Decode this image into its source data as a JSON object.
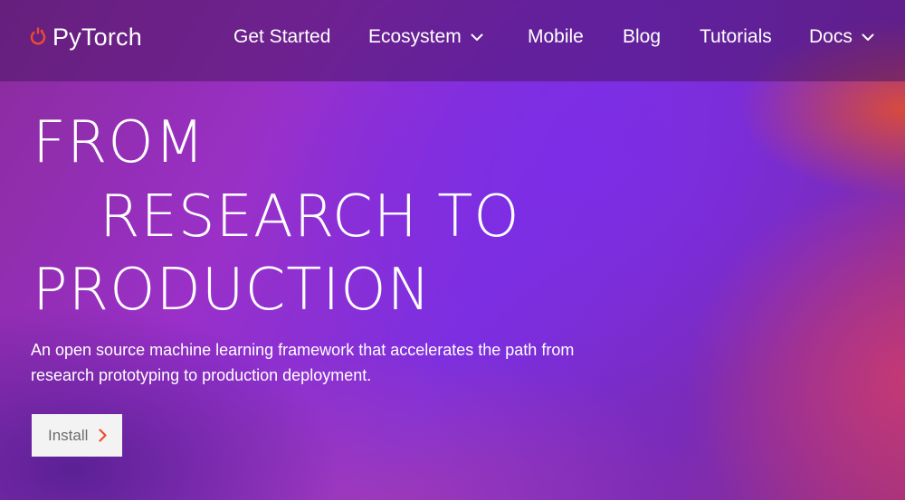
{
  "brand": {
    "name": "PyTorch",
    "logo_icon": "pytorch-flame-icon",
    "accent_color": "#ee4c2c"
  },
  "nav": {
    "items": [
      {
        "label": "Get Started",
        "has_dropdown": false
      },
      {
        "label": "Ecosystem",
        "has_dropdown": true,
        "icon": "chevron-down-icon"
      },
      {
        "label": "Mobile",
        "has_dropdown": false
      },
      {
        "label": "Blog",
        "has_dropdown": false
      },
      {
        "label": "Tutorials",
        "has_dropdown": false
      },
      {
        "label": "Docs",
        "has_dropdown": true,
        "icon": "chevron-down-icon"
      }
    ]
  },
  "hero": {
    "headline": [
      "FROM",
      "RESEARCH TO",
      "PRODUCTION"
    ],
    "tagline": "An open source machine learning framework that accelerates the path from research prototyping to production deployment.",
    "cta_label": "Install",
    "cta_icon": "chevron-right-icon"
  }
}
